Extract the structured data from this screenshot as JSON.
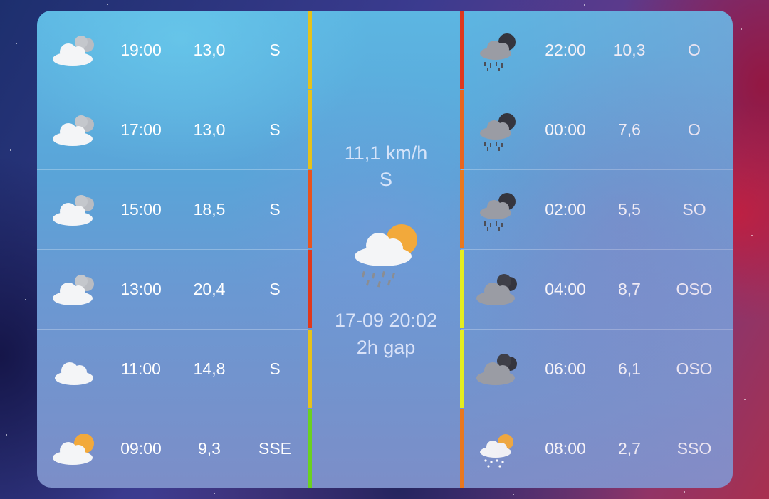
{
  "left_column": [
    {
      "time": "19:00",
      "temp": "13,0",
      "dir": "S",
      "icon": "cloudy-icon",
      "bar_color": "#e6c21a"
    },
    {
      "time": "17:00",
      "temp": "13,0",
      "dir": "S",
      "icon": "cloudy-icon",
      "bar_color": "#e6c21a"
    },
    {
      "time": "15:00",
      "temp": "18,5",
      "dir": "S",
      "icon": "cloudy-icon",
      "bar_color": "#e8531e"
    },
    {
      "time": "13:00",
      "temp": "20,4",
      "dir": "S",
      "icon": "cloudy-icon",
      "bar_color": "#e0381c"
    },
    {
      "time": "11:00",
      "temp": "14,8",
      "dir": "S",
      "icon": "cloud-icon",
      "bar_color": "#e6c21a"
    },
    {
      "time": "09:00",
      "temp": "9,3",
      "dir": "SSE",
      "icon": "partly-sunny-icon",
      "bar_color": "#6bd11f"
    }
  ],
  "right_column": [
    {
      "time": "22:00",
      "temp": "10,3",
      "dir": "O",
      "icon": "night-rain-icon",
      "bar_color": "#e0381c"
    },
    {
      "time": "00:00",
      "temp": "7,6",
      "dir": "O",
      "icon": "night-rain-icon",
      "bar_color": "#e8651e"
    },
    {
      "time": "02:00",
      "temp": "5,5",
      "dir": "SO",
      "icon": "night-rain-icon",
      "bar_color": "#e8781e"
    },
    {
      "time": "04:00",
      "temp": "8,7",
      "dir": "OSO",
      "icon": "night-cloudy-icon",
      "bar_color": "#e4ee1e"
    },
    {
      "time": "06:00",
      "temp": "6,1",
      "dir": "OSO",
      "icon": "night-cloudy-icon",
      "bar_color": "#e4ee1e"
    },
    {
      "time": "08:00",
      "temp": "2,7",
      "dir": "SSO",
      "icon": "sunny-snow-icon",
      "bar_color": "#e8781e"
    }
  ],
  "current": {
    "wind_speed": "11,1 km/h",
    "wind_dir": "S",
    "icon": "rain-sun-icon",
    "date": "17-09 20:02",
    "gap": "2h gap"
  }
}
